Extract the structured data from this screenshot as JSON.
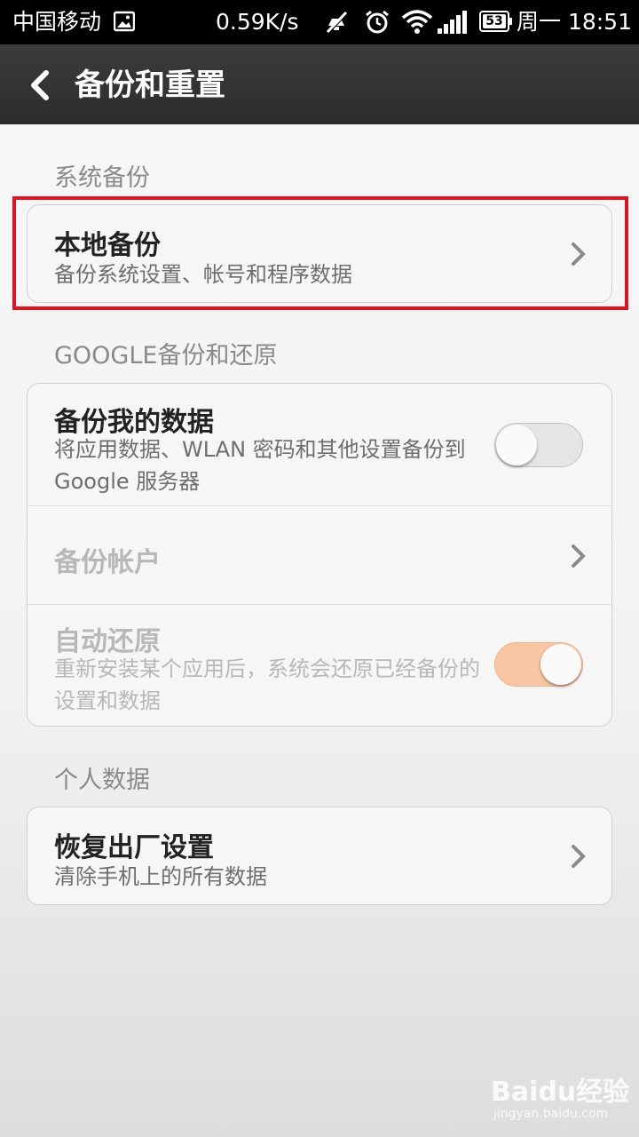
{
  "status_bar": {
    "carrier": "中国移动",
    "speed": "0.59K/s",
    "battery": "53",
    "time": "周一 18:51",
    "icons": [
      "image-icon",
      "silent-icon",
      "alarm-icon",
      "wifi-icon",
      "signal-icon",
      "battery-icon"
    ]
  },
  "header": {
    "title": "备份和重置",
    "back_icon": "back-arrow-icon"
  },
  "sections": {
    "system_backup": {
      "header": "系统备份",
      "items": [
        {
          "title": "本地备份",
          "subtitle": "备份系统设置、帐号和程序数据"
        }
      ]
    },
    "google": {
      "header": "GOOGLE备份和还原",
      "items": [
        {
          "title": "备份我的数据",
          "subtitle": "将应用数据、WLAN 密码和其他设置备份到 Google 服务器",
          "toggle": "off"
        },
        {
          "title": "备份帐户",
          "disabled": true
        },
        {
          "title": "自动还原",
          "subtitle": "重新安装某个应用后，系统会还原已经备份的设置和数据",
          "toggle": "on",
          "disabled": true
        }
      ]
    },
    "personal": {
      "header": "个人数据",
      "items": [
        {
          "title": "恢复出厂设置",
          "subtitle": "清除手机上的所有数据"
        }
      ]
    }
  },
  "highlight_color": "#e0141e",
  "toggle_on_color": "#f7c6a3",
  "watermark": {
    "logo": "Baidu经验",
    "url": "jingyan.baidu.com"
  }
}
